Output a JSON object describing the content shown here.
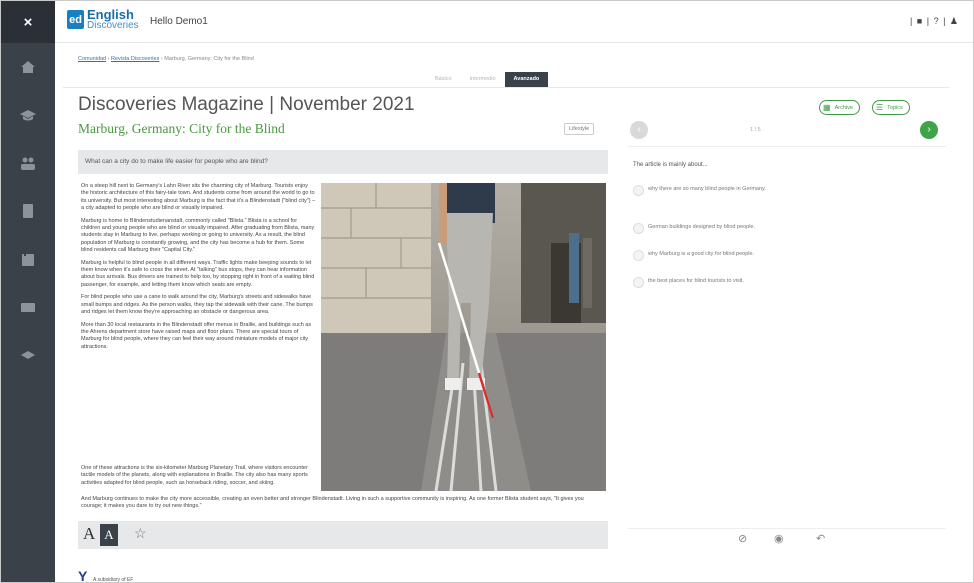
{
  "header": {
    "logo_mark": "ed",
    "logo_english": "English",
    "logo_discoveries": "Discoveries",
    "greeting": "Hello Demo1",
    "top_right": "| ■ | ? | ♟"
  },
  "sidebar": {
    "close": "×"
  },
  "breadcrumb": {
    "item1": "Comunidad",
    "item2": "Revista Discoveries",
    "current": "Marburg, Germany: City for the Blind"
  },
  "levels": [
    {
      "label": "Básico",
      "active": false
    },
    {
      "label": "Intermedio",
      "active": false
    },
    {
      "label": "Avanzado",
      "active": true
    }
  ],
  "magazine_title": "Discoveries Magazine | November 2021",
  "article_title": "Marburg, Germany: City for the Blind",
  "tag": "Lifestyle",
  "prompt_question": "What can a city do to make life easier for people who are blind?",
  "article": {
    "p1": "On a steep hill next to Germany's Lahn River sits the charming city of Marburg. Tourists enjoy the historic architecture of this fairy-tale town. And students come from around the world to go to its university. But most interesting about Marburg is the fact that it's a Blindenstadt (\"blind city\") – a city adapted to people who are blind or visually impaired.",
    "p2": "Marburg is home to Blindenstudienanstalt, commonly called \"Blista.\" Blista is a school for children and young people who are blind or visually impaired. After graduating from Blista, many students stay in Marburg to live, perhaps working or going to university. As a result, the blind population of Marburg is constantly growing, and the city has become a hub for them. Some blind residents call Marburg their \"Capital City.\"",
    "p3": "Marburg is helpful to blind people in all different ways. Traffic lights make beeping sounds to let them know when it's safe to cross the street. At \"talking\" bus stops, they can hear information about bus arrivals. Bus drivers are trained to help too, by stopping right in front of a waiting blind passenger, for example, and letting them know which seats are empty.",
    "p4": "For blind people who use a cane to walk around the city, Marburg's streets and sidewalks have small bumps and ridges. As the person walks, they tap the sidewalk with their cane. The bumps and ridges let them know they're approaching an obstacle or dangerous area.",
    "p5": "More than 30 local restaurants in the Blindenstadt offer menus in Braille, and buildings such as the Ahrens department store have raised maps and floor plans. There are special tours of Marburg for blind people, where they can feel their way around miniature models of major city attractions.",
    "p6": "One of these attractions is the six-kilometer Marburg Planetary Trail, where visitors encounter tactile models of the planets, along with explanations in Braille. The city also has many sports activities adapted for blind people, such as horseback riding, soccer, and skiing.",
    "p7": "And Marburg continues to make the city more accessible, creating an even better and stronger Blindenstadt. Living in such a supportive community is inspiring. As one former Blista student says, \"It gives you courage; it makes you dare to try out new things.\""
  },
  "toolbar": {
    "font_small": "A",
    "font_large": "A",
    "favorite": "☆"
  },
  "right_panel": {
    "archive_label": "Archive",
    "topics_label": "Topics",
    "pager": "1 / 5",
    "question": "The article is mainly about...",
    "options": [
      "why there are so many blind people in Germany.",
      "German buildings designed by blind people.",
      "why Marburg is a good city for blind people.",
      "the best places for blind tourists to visit."
    ]
  },
  "footer": {
    "logo": "Y",
    "text": "A subsidiary of EF"
  },
  "colors": {
    "sidebar": "#3b4148",
    "accent_green": "#3fa447",
    "title_green": "#4a9a3f",
    "brand_blue": "#1a7fc1"
  }
}
